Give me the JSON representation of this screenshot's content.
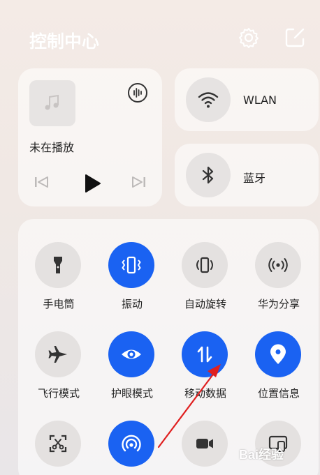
{
  "header": {
    "title": "控制中心"
  },
  "media": {
    "status": "未在播放"
  },
  "wlan": {
    "label": "WLAN"
  },
  "bluetooth": {
    "label": "蓝牙"
  },
  "tiles": [
    {
      "label": "手电筒",
      "icon": "flashlight-icon",
      "active": false
    },
    {
      "label": "振动",
      "icon": "vibrate-icon",
      "active": true
    },
    {
      "label": "自动旋转",
      "icon": "auto-rotate-icon",
      "active": false
    },
    {
      "label": "华为分享",
      "icon": "huawei-share-icon",
      "active": false
    },
    {
      "label": "飞行模式",
      "icon": "airplane-icon",
      "active": false
    },
    {
      "label": "护眼模式",
      "icon": "eye-icon",
      "active": true
    },
    {
      "label": "移动数据",
      "icon": "mobile-data-icon",
      "active": true
    },
    {
      "label": "位置信息",
      "icon": "location-icon",
      "active": true
    },
    {
      "label": "",
      "icon": "screenshot-icon",
      "active": false
    },
    {
      "label": "",
      "icon": "hotspot-icon",
      "active": true
    },
    {
      "label": "",
      "icon": "screen-record-icon",
      "active": false
    },
    {
      "label": "",
      "icon": "screen-cast-icon",
      "active": false
    }
  ],
  "colors": {
    "accent": "#1a62f2",
    "annotation": "#e02020"
  },
  "watermark": {
    "text": "Bai经验"
  }
}
